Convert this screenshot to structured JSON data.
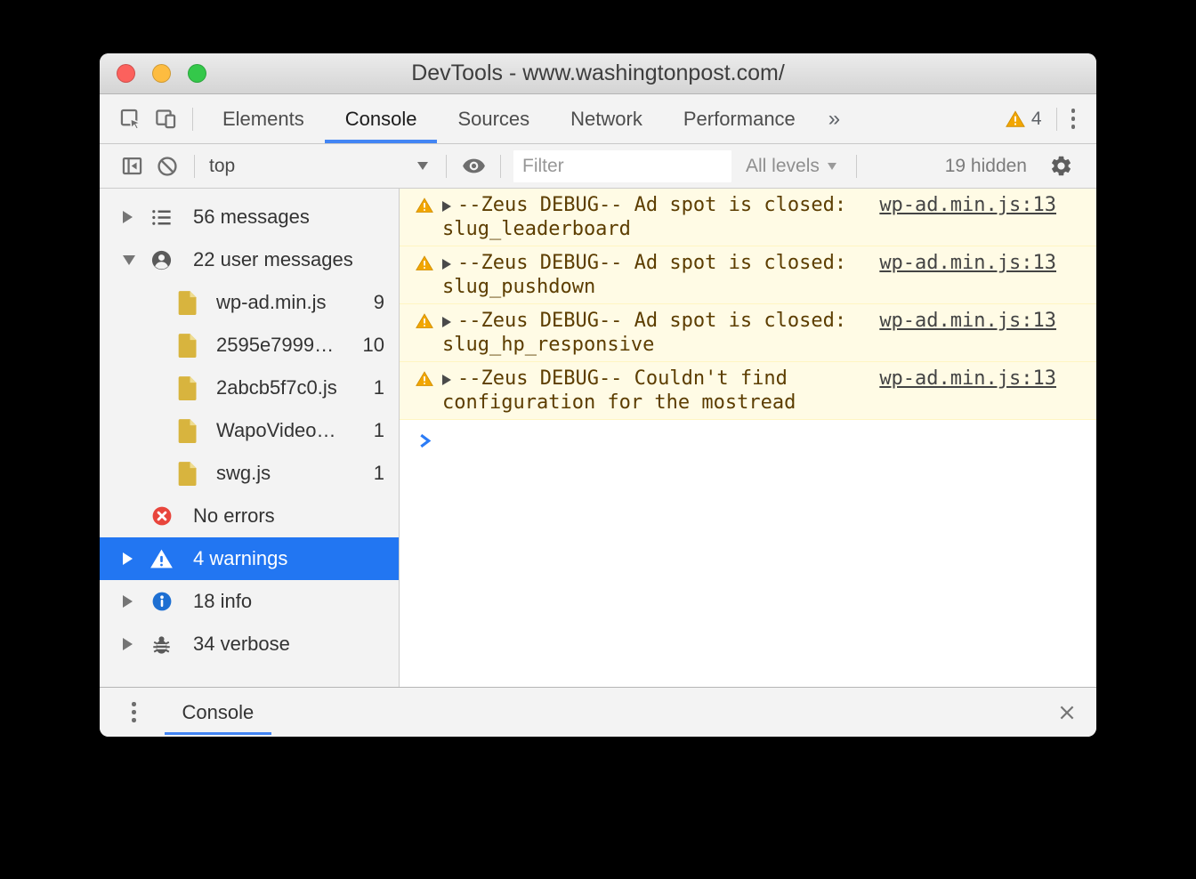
{
  "colors": {
    "accent-blue": "#4285f4",
    "selection-blue": "#2276f2",
    "warning-bg": "#fffbe5",
    "warning-border": "#fff5c2",
    "warning-text": "#5c3d00",
    "warning-icon": "#f2a600",
    "error-red": "#e8453c",
    "info-blue": "#1d6fd2",
    "file-icon": "#d8b43e",
    "link-gray": "#444444",
    "prompt-blue": "#2c7cf6"
  },
  "titlebar": {
    "title": "DevTools - www.washingtonpost.com/"
  },
  "tabbar": {
    "tabs": [
      {
        "label": "Elements"
      },
      {
        "label": "Console"
      },
      {
        "label": "Sources"
      },
      {
        "label": "Network"
      },
      {
        "label": "Performance"
      }
    ],
    "overflow": "»",
    "warning_count": "4"
  },
  "toolbar": {
    "context": "top",
    "filter_placeholder": "Filter",
    "levels_label": "All levels",
    "hidden_label": "19 hidden"
  },
  "sidebar": {
    "items": [
      {
        "label": "56 messages",
        "count": ""
      },
      {
        "label": "22 user messages",
        "count": ""
      },
      {
        "label": "wp-ad.min.js",
        "count": "9"
      },
      {
        "label": "2595e7999…",
        "count": "10"
      },
      {
        "label": "2abcb5f7c0.js",
        "count": "1"
      },
      {
        "label": "WapoVideo…",
        "count": "1"
      },
      {
        "label": "swg.js",
        "count": "1"
      },
      {
        "label": "No errors",
        "count": ""
      },
      {
        "label": "4 warnings",
        "count": ""
      },
      {
        "label": "18 info",
        "count": ""
      },
      {
        "label": "34 verbose",
        "count": ""
      }
    ]
  },
  "console": {
    "messages": [
      {
        "text": "--Zeus DEBUG-- Ad spot is closed: slug_leaderboard",
        "source": "wp-ad.min.js:13"
      },
      {
        "text": "--Zeus DEBUG-- Ad spot is closed: slug_pushdown",
        "source": "wp-ad.min.js:13"
      },
      {
        "text": "--Zeus DEBUG-- Ad spot is closed: slug_hp_responsive",
        "source": "wp-ad.min.js:13"
      },
      {
        "text": "--Zeus DEBUG-- Couldn't find configuration for the mostread",
        "source": "wp-ad.min.js:13"
      }
    ]
  },
  "drawer": {
    "tab": "Console"
  }
}
